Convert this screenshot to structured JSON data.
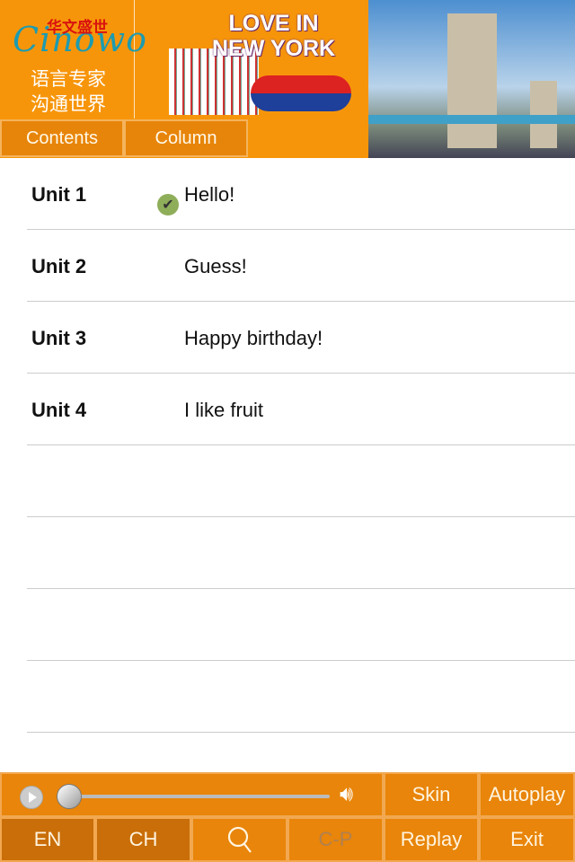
{
  "header": {
    "logo": {
      "brand_cn": "华文盛世",
      "brand_en": "Cinowo",
      "slogan_line1": "语言专家",
      "slogan_line2": "沟通世界"
    },
    "banner": {
      "title_line1": "LOVE IN",
      "title_line2": "NEW YORK"
    },
    "tabs": [
      {
        "label": "Contents"
      },
      {
        "label": "Column"
      }
    ]
  },
  "units": [
    {
      "unit": "Unit 1",
      "title": "Hello!",
      "completed": true
    },
    {
      "unit": "Unit 2",
      "title": "Guess!",
      "completed": false
    },
    {
      "unit": "Unit 3",
      "title": "Happy birthday!",
      "completed": false
    },
    {
      "unit": "Unit 4",
      "title": "I like fruit",
      "completed": false
    }
  ],
  "player": {
    "progress": 0,
    "icons": [
      "play-icon",
      "volume-icon"
    ]
  },
  "toolbar": {
    "skin": "Skin",
    "autoplay": "Autoplay",
    "en": "EN",
    "ch": "CH",
    "cp": "C-P",
    "replay": "Replay",
    "exit": "Exit"
  },
  "colors": {
    "accent": "#f7950a",
    "button": "#e8850a",
    "button_active": "#c96e08",
    "check": "#8fae5a"
  }
}
